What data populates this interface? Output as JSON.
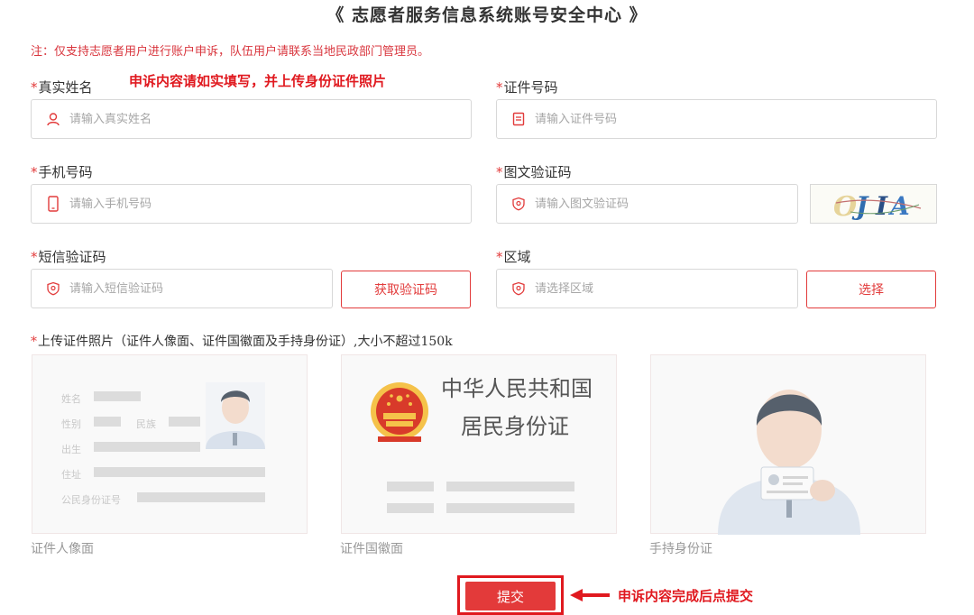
{
  "page": {
    "title": "《 志愿者服务信息系统账号安全中心 》",
    "notice": "注：仅支持志愿者用户进行账户申诉，队伍用户请联系当地民政部门管理员。"
  },
  "annotations": {
    "fill_hint": "申诉内容请如实填写，并上传身份证件照片",
    "submit_hint": "申诉内容完成后点提交"
  },
  "form": {
    "required_mark": "*",
    "real_name": {
      "label": "真实姓名",
      "placeholder": "请输入真实姓名",
      "icon": "user-icon"
    },
    "id_number": {
      "label": "证件号码",
      "placeholder": "请输入证件号码",
      "icon": "document-icon"
    },
    "phone": {
      "label": "手机号码",
      "placeholder": "请输入手机号码",
      "icon": "phone-icon"
    },
    "captcha": {
      "label": "图文验证码",
      "placeholder": "请输入图文验证码",
      "icon": "shield-icon",
      "image_text": "OJIA"
    },
    "sms_code": {
      "label": "短信验证码",
      "placeholder": "请输入短信验证码",
      "icon": "shield-icon",
      "button": "获取验证码"
    },
    "region": {
      "label": "区域",
      "placeholder": "请选择区域",
      "icon": "shield-icon",
      "button": "选择"
    },
    "upload": {
      "label": "上传证件照片（证件人像面、证件国徽面及手持身份证）,大小不超过150k",
      "slots": [
        {
          "caption": "证件人像面",
          "fields": [
            "姓名",
            "性别",
            "民族",
            "出生",
            "住址",
            "公民身份证号"
          ]
        },
        {
          "caption": "证件国徽面",
          "line1": "中华人民共和国",
          "line2": "居民身份证"
        },
        {
          "caption": "手持身份证"
        }
      ]
    },
    "submit": "提交"
  },
  "colors": {
    "accent": "#e23b3b",
    "annotation": "#e0191f",
    "border": "#d8d8d8",
    "placeholder": "#a6a6a6"
  }
}
